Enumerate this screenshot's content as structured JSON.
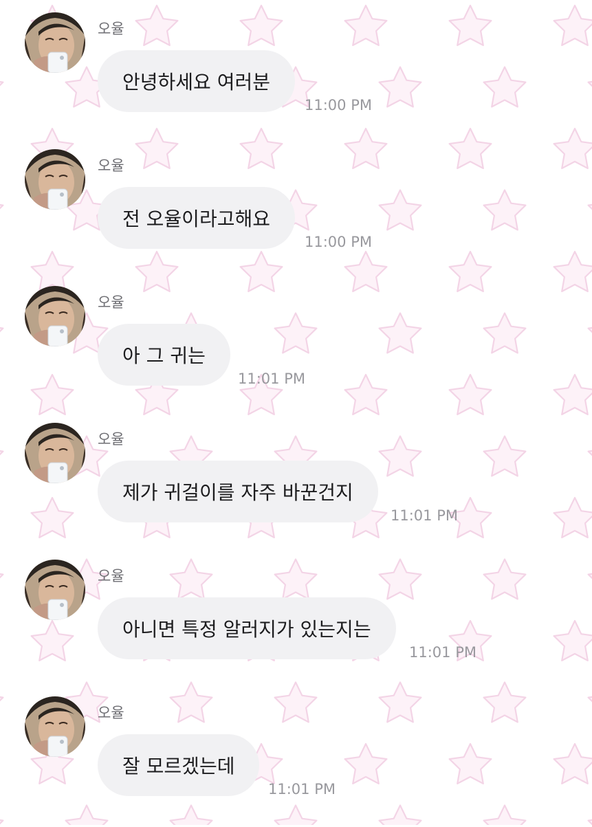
{
  "sender": {
    "name": "오율"
  },
  "messages": [
    {
      "text": "안녕하세요 여러분",
      "time": "11:00 PM"
    },
    {
      "text": "전 오율이라고해요",
      "time": "11:00 PM"
    },
    {
      "text": "아 그 귀는",
      "time": "11:01 PM"
    },
    {
      "text": "제가 귀걸이를 자주 바꾼건지",
      "time": "11:01 PM"
    },
    {
      "text": "아니면 특정 알러지가 있는지는",
      "time": "11:01 PM"
    },
    {
      "text": "잘 모르겠는데",
      "time": "11:01 PM"
    }
  ],
  "colors": {
    "bubble": "#f1f1f3",
    "text": "#1c1c1e",
    "name": "#6e6e73",
    "timestamp": "#98989d",
    "wallpaper_star": "#f3d4e6"
  }
}
